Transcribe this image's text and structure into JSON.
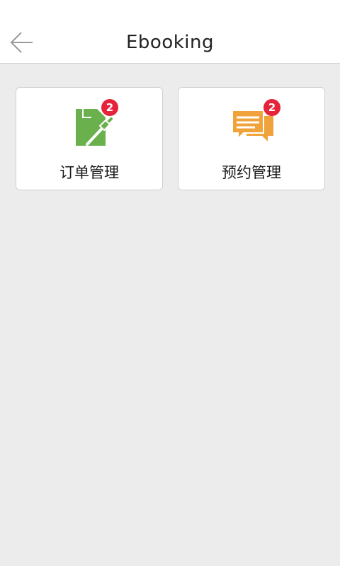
{
  "header": {
    "title": "Ebooking",
    "back_icon": "arrow-left-icon"
  },
  "tiles": [
    {
      "label": "订单管理",
      "icon": "document-edit-icon",
      "icon_color": "#6ab04c",
      "badge": "2"
    },
    {
      "label": "预约管理",
      "icon": "chat-bubbles-icon",
      "icon_color": "#f0a33a",
      "badge": "2"
    }
  ],
  "colors": {
    "background": "#ececec",
    "badge": "#e5243b"
  }
}
